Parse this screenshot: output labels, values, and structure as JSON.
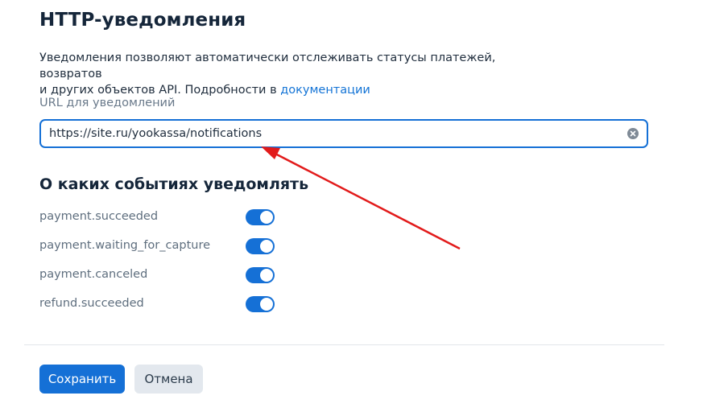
{
  "header": {
    "title": "HTTP-уведомления"
  },
  "description": {
    "line1": "Уведомления позволяют автоматически отслеживать статусы платежей, возвратов",
    "line2": "и других объектов API. Подробности в ",
    "link_text": "документации"
  },
  "url_field": {
    "label": "URL для уведомлений",
    "value": "https://site.ru/yookassa/notifications"
  },
  "events_section": {
    "title": "О каких событиях уведомлять",
    "events": [
      {
        "label": "payment.succeeded",
        "enabled": true
      },
      {
        "label": "payment.waiting_for_capture",
        "enabled": true
      },
      {
        "label": "payment.canceled",
        "enabled": true
      },
      {
        "label": "refund.succeeded",
        "enabled": true
      }
    ]
  },
  "actions": {
    "save_label": "Сохранить",
    "cancel_label": "Отмена"
  },
  "colors": {
    "accent": "#1570d6",
    "annotation_arrow": "#e21b1b"
  }
}
